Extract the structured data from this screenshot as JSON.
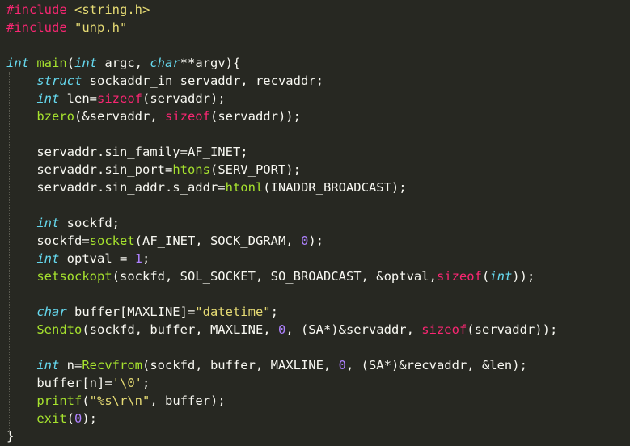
{
  "editor": {
    "theme": "monokai",
    "colors": {
      "background": "#272822",
      "plain": "#f8f8f2",
      "directive": "#f92672",
      "string": "#e6db74",
      "keyword": "#66d9ef",
      "function": "#a6e22e",
      "number": "#ae81ff"
    },
    "lines": [
      [
        {
          "t": "directive",
          "v": "#include"
        },
        {
          "t": "plain",
          "v": " "
        },
        {
          "t": "string",
          "v": "<string.h>"
        }
      ],
      [
        {
          "t": "directive",
          "v": "#include"
        },
        {
          "t": "plain",
          "v": " "
        },
        {
          "t": "string",
          "v": "\"unp.h\""
        }
      ],
      [],
      [
        {
          "t": "keyword",
          "v": "int"
        },
        {
          "t": "plain",
          "v": " "
        },
        {
          "t": "func",
          "v": "main"
        },
        {
          "t": "plain",
          "v": "("
        },
        {
          "t": "keyword",
          "v": "int"
        },
        {
          "t": "plain",
          "v": " argc, "
        },
        {
          "t": "keyword",
          "v": "char"
        },
        {
          "t": "plain",
          "v": "**argv){"
        }
      ],
      [
        {
          "t": "plain",
          "v": "    "
        },
        {
          "t": "keyword",
          "v": "struct"
        },
        {
          "t": "plain",
          "v": " sockaddr_in servaddr, recvaddr;"
        }
      ],
      [
        {
          "t": "plain",
          "v": "    "
        },
        {
          "t": "keyword",
          "v": "int"
        },
        {
          "t": "plain",
          "v": " len="
        },
        {
          "t": "operator-fn",
          "v": "sizeof"
        },
        {
          "t": "plain",
          "v": "(servaddr);"
        }
      ],
      [
        {
          "t": "plain",
          "v": "    "
        },
        {
          "t": "func",
          "v": "bzero"
        },
        {
          "t": "plain",
          "v": "(&servaddr, "
        },
        {
          "t": "operator-fn",
          "v": "sizeof"
        },
        {
          "t": "plain",
          "v": "(servaddr));"
        }
      ],
      [],
      [
        {
          "t": "plain",
          "v": "    servaddr.sin_family=AF_INET;"
        }
      ],
      [
        {
          "t": "plain",
          "v": "    servaddr.sin_port="
        },
        {
          "t": "func",
          "v": "htons"
        },
        {
          "t": "plain",
          "v": "(SERV_PORT);"
        }
      ],
      [
        {
          "t": "plain",
          "v": "    servaddr.sin_addr.s_addr="
        },
        {
          "t": "func",
          "v": "htonl"
        },
        {
          "t": "plain",
          "v": "(INADDR_BROADCAST);"
        }
      ],
      [],
      [
        {
          "t": "plain",
          "v": "    "
        },
        {
          "t": "keyword",
          "v": "int"
        },
        {
          "t": "plain",
          "v": " sockfd;"
        }
      ],
      [
        {
          "t": "plain",
          "v": "    sockfd="
        },
        {
          "t": "func",
          "v": "socket"
        },
        {
          "t": "plain",
          "v": "(AF_INET, SOCK_DGRAM, "
        },
        {
          "t": "number",
          "v": "0"
        },
        {
          "t": "plain",
          "v": ");"
        }
      ],
      [
        {
          "t": "plain",
          "v": "    "
        },
        {
          "t": "keyword",
          "v": "int"
        },
        {
          "t": "plain",
          "v": " optval = "
        },
        {
          "t": "number",
          "v": "1"
        },
        {
          "t": "plain",
          "v": ";"
        }
      ],
      [
        {
          "t": "plain",
          "v": "    "
        },
        {
          "t": "func",
          "v": "setsockopt"
        },
        {
          "t": "plain",
          "v": "(sockfd, SOL_SOCKET, SO_BROADCAST, &optval,"
        },
        {
          "t": "operator-fn",
          "v": "sizeof"
        },
        {
          "t": "plain",
          "v": "("
        },
        {
          "t": "keyword",
          "v": "int"
        },
        {
          "t": "plain",
          "v": "));"
        }
      ],
      [],
      [
        {
          "t": "plain",
          "v": "    "
        },
        {
          "t": "keyword",
          "v": "char"
        },
        {
          "t": "plain",
          "v": " buffer[MAXLINE]="
        },
        {
          "t": "string",
          "v": "\"datetime\""
        },
        {
          "t": "plain",
          "v": ";"
        }
      ],
      [
        {
          "t": "plain",
          "v": "    "
        },
        {
          "t": "func",
          "v": "Sendto"
        },
        {
          "t": "plain",
          "v": "(sockfd, buffer, MAXLINE, "
        },
        {
          "t": "number",
          "v": "0"
        },
        {
          "t": "plain",
          "v": ", (SA*)&servaddr, "
        },
        {
          "t": "operator-fn",
          "v": "sizeof"
        },
        {
          "t": "plain",
          "v": "(servaddr));"
        }
      ],
      [],
      [
        {
          "t": "plain",
          "v": "    "
        },
        {
          "t": "keyword",
          "v": "int"
        },
        {
          "t": "plain",
          "v": " n="
        },
        {
          "t": "func",
          "v": "Recvfrom"
        },
        {
          "t": "plain",
          "v": "(sockfd, buffer, MAXLINE, "
        },
        {
          "t": "number",
          "v": "0"
        },
        {
          "t": "plain",
          "v": ", (SA*)&recvaddr, &len);"
        }
      ],
      [
        {
          "t": "plain",
          "v": "    buffer[n]="
        },
        {
          "t": "string",
          "v": "'\\0'"
        },
        {
          "t": "plain",
          "v": ";"
        }
      ],
      [
        {
          "t": "plain",
          "v": "    "
        },
        {
          "t": "func",
          "v": "printf"
        },
        {
          "t": "plain",
          "v": "("
        },
        {
          "t": "string",
          "v": "\"%s\\r\\n\""
        },
        {
          "t": "plain",
          "v": ", buffer);"
        }
      ],
      [
        {
          "t": "plain",
          "v": "    "
        },
        {
          "t": "func",
          "v": "exit"
        },
        {
          "t": "plain",
          "v": "("
        },
        {
          "t": "number",
          "v": "0"
        },
        {
          "t": "plain",
          "v": ");"
        }
      ],
      [
        {
          "t": "plain",
          "v": "}"
        }
      ]
    ]
  }
}
